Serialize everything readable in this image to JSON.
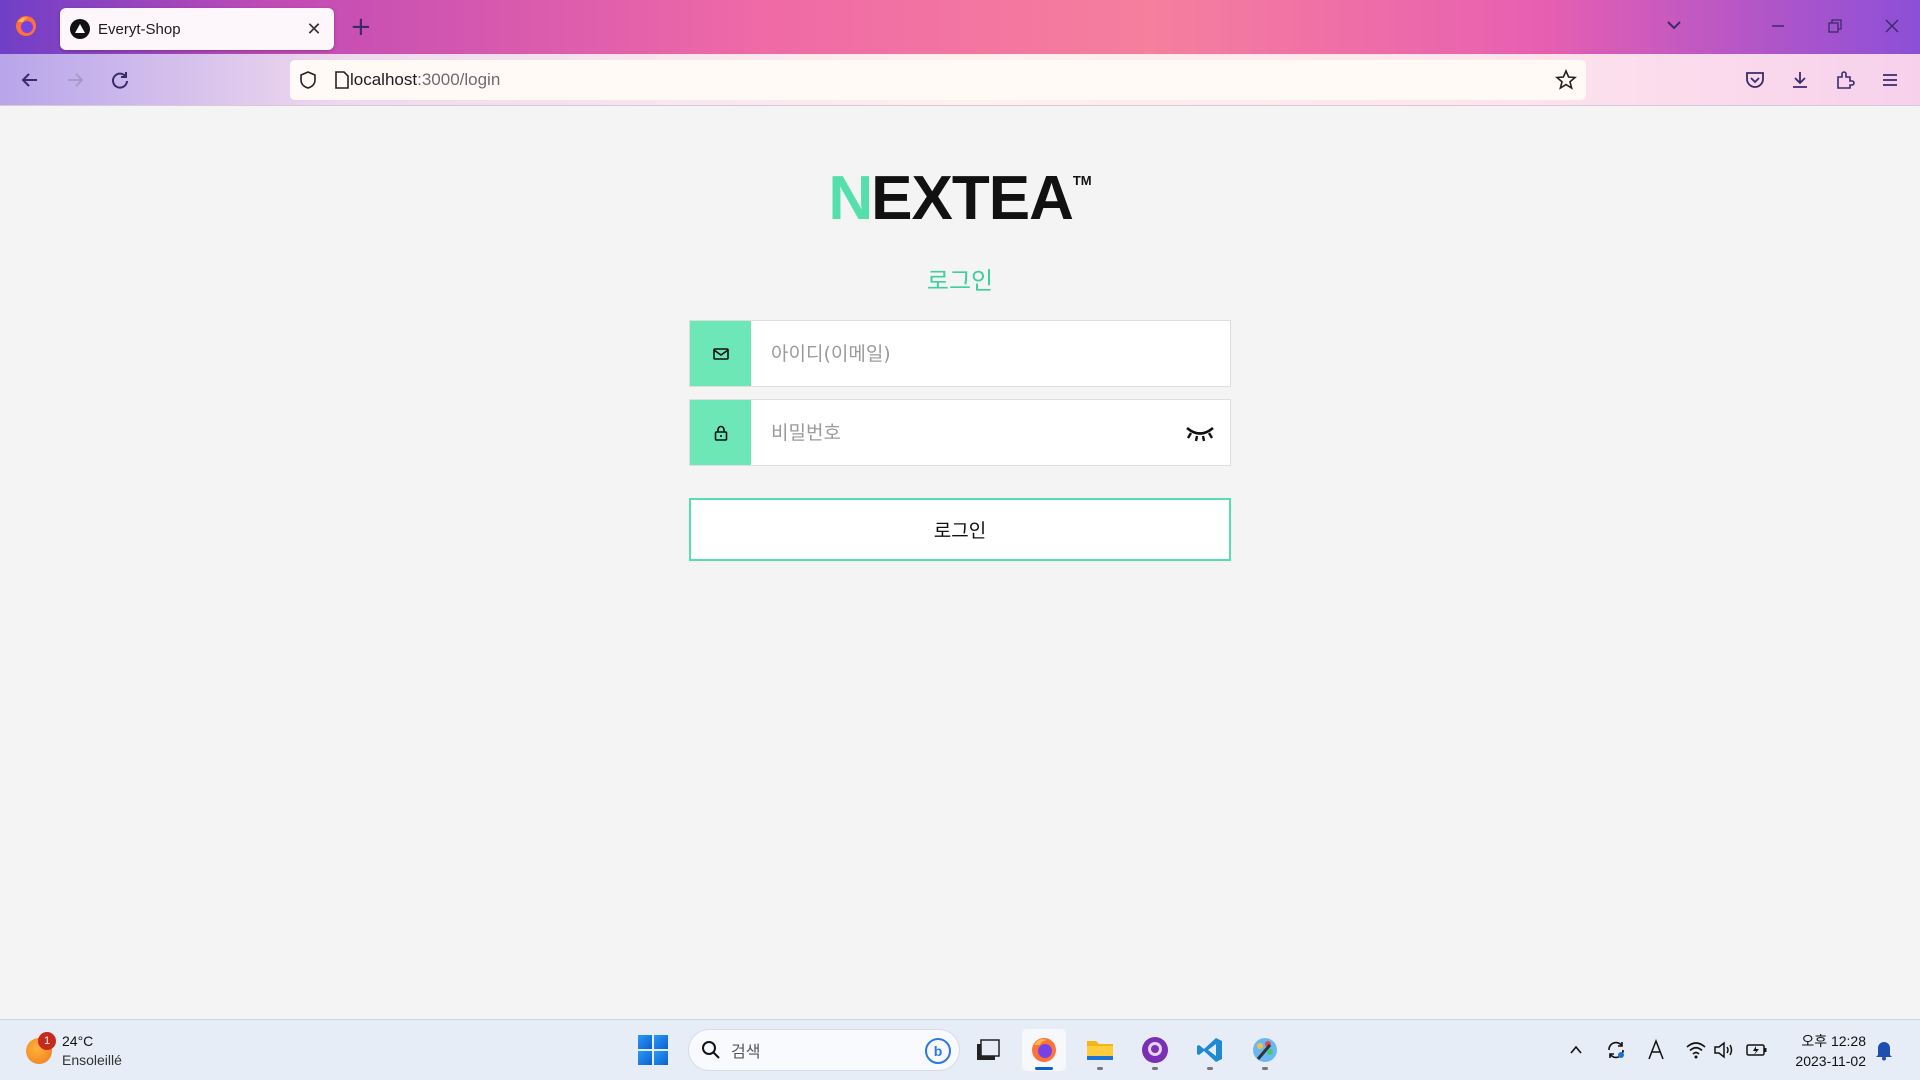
{
  "browser": {
    "tab_title": "Everyt-Shop",
    "url_host": "localhost",
    "url_path": ":3000/login"
  },
  "page": {
    "logo_first": "N",
    "logo_rest": "EXTEA",
    "logo_tm": "TM",
    "title": "로그인",
    "email_placeholder": "아이디(이메일)",
    "password_placeholder": "비밀번호",
    "login_button": "로그인"
  },
  "taskbar": {
    "weather_temp": "24°C",
    "weather_desc": "Ensoleillé",
    "weather_badge": "1",
    "search_placeholder": "검색",
    "clock_time": "오후 12:28",
    "clock_date": "2023-11-02"
  },
  "colors": {
    "accent": "#6ee7b7",
    "accent_dark": "#3ed09c",
    "logo_green": "#54e0ad"
  }
}
